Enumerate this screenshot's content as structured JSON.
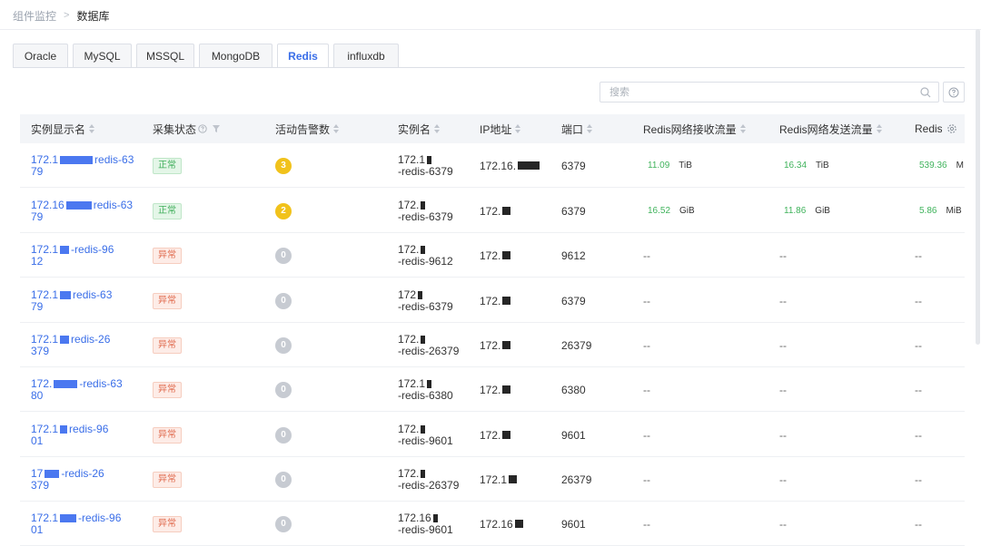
{
  "breadcrumb": {
    "parent": "组件监控",
    "separator": ">",
    "current": "数据库"
  },
  "tabs": [
    {
      "label": "Oracle",
      "active": false
    },
    {
      "label": "MySQL",
      "active": false
    },
    {
      "label": "MSSQL",
      "active": false
    },
    {
      "label": "MongoDB",
      "active": false
    },
    {
      "label": "Redis",
      "active": true
    },
    {
      "label": "influxdb",
      "active": false
    }
  ],
  "search": {
    "placeholder": "搜索"
  },
  "columns": [
    "实例显示名",
    "采集状态",
    "活动告警数",
    "实例名",
    "IP地址",
    "端口",
    "Redis网络接收流量",
    "Redis网络发送流量",
    "Redis"
  ],
  "rows": [
    {
      "display_line1_a": "172.1",
      "display_line1_b": "redis-63",
      "display_line2": "79",
      "status": "正常",
      "status_ok": true,
      "alerts": "3",
      "instance_line1": "172.1",
      "instance_line2": "-redis-6379",
      "ip": "172.16.",
      "port": "6379",
      "recv_value": "11.09",
      "recv_unit": "TiB",
      "send_value": "16.34",
      "send_unit": "TiB",
      "extra_value": "539.36",
      "extra_unit": "M"
    },
    {
      "display_line1_a": "172.16",
      "display_line1_b": "redis-63",
      "display_line2": "79",
      "status": "正常",
      "status_ok": true,
      "alerts": "2",
      "instance_line1": "172.",
      "instance_line2": "-redis-6379",
      "ip": "172.",
      "port": "6379",
      "recv_value": "16.52",
      "recv_unit": "GiB",
      "send_value": "11.86",
      "send_unit": "GiB",
      "extra_value": "5.86",
      "extra_unit": "MiB"
    },
    {
      "display_line1_a": "172.1",
      "display_line1_b": "-redis-96",
      "display_line2": "12",
      "status": "异常",
      "status_ok": false,
      "alerts": "0",
      "instance_line1": "172.",
      "instance_line2": "-redis-9612",
      "ip": "172.",
      "port": "9612",
      "recv_value": "--",
      "recv_unit": "",
      "send_value": "--",
      "send_unit": "",
      "extra_value": "--",
      "extra_unit": ""
    },
    {
      "display_line1_a": "172.1",
      "display_line1_b": "redis-63",
      "display_line2": "79",
      "status": "异常",
      "status_ok": false,
      "alerts": "0",
      "instance_line1": "172",
      "instance_line2": "-redis-6379",
      "ip": "172.",
      "port": "6379",
      "recv_value": "--",
      "recv_unit": "",
      "send_value": "--",
      "send_unit": "",
      "extra_value": "--",
      "extra_unit": ""
    },
    {
      "display_line1_a": "172.1",
      "display_line1_b": "redis-26",
      "display_line2": "379",
      "status": "异常",
      "status_ok": false,
      "alerts": "0",
      "instance_line1": "172.",
      "instance_line2": "-redis-26379",
      "ip": "172.",
      "port": "26379",
      "recv_value": "--",
      "recv_unit": "",
      "send_value": "--",
      "send_unit": "",
      "extra_value": "--",
      "extra_unit": ""
    },
    {
      "display_line1_a": "172.",
      "display_line1_b": "-redis-63",
      "display_line2": "80",
      "status": "异常",
      "status_ok": false,
      "alerts": "0",
      "instance_line1": "172.1",
      "instance_line2": "-redis-6380",
      "ip": "172.",
      "port": "6380",
      "recv_value": "--",
      "recv_unit": "",
      "send_value": "--",
      "send_unit": "",
      "extra_value": "--",
      "extra_unit": ""
    },
    {
      "display_line1_a": "172.1",
      "display_line1_b": "redis-96",
      "display_line2": "01",
      "status": "异常",
      "status_ok": false,
      "alerts": "0",
      "instance_line1": "172.",
      "instance_line2": "-redis-9601",
      "ip": "172.",
      "port": "9601",
      "recv_value": "--",
      "recv_unit": "",
      "send_value": "--",
      "send_unit": "",
      "extra_value": "--",
      "extra_unit": ""
    },
    {
      "display_line1_a": "17",
      "display_line1_b": "-redis-26",
      "display_line2": "379",
      "status": "异常",
      "status_ok": false,
      "alerts": "0",
      "instance_line1": "172.",
      "instance_line2": "-redis-26379",
      "ip": "172.1",
      "port": "26379",
      "recv_value": "--",
      "recv_unit": "",
      "send_value": "--",
      "send_unit": "",
      "extra_value": "--",
      "extra_unit": ""
    },
    {
      "display_line1_a": "172.1",
      "display_line1_b": "-redis-96",
      "display_line2": "01",
      "status": "异常",
      "status_ok": false,
      "alerts": "0",
      "instance_line1": "172.16",
      "instance_line2": "-redis-9601",
      "ip": "172.16",
      "port": "9601",
      "recv_value": "--",
      "recv_unit": "",
      "send_value": "--",
      "send_unit": "",
      "extra_value": "--",
      "extra_unit": ""
    }
  ],
  "colors": {
    "accent": "#3a6ee8",
    "status_ok": "#3fae5a",
    "status_bad": "#e0684b",
    "alert_active": "#f1c21b",
    "alert_zero": "#c7cbd2",
    "traffic_value": "#40b35c"
  },
  "icons": {
    "breadcrumb_separator": "chevron-right-icon",
    "search": "search-icon",
    "help": "help-circle-icon",
    "sort": "sort-icon",
    "filter": "filter-icon",
    "settings": "settings-icon"
  }
}
